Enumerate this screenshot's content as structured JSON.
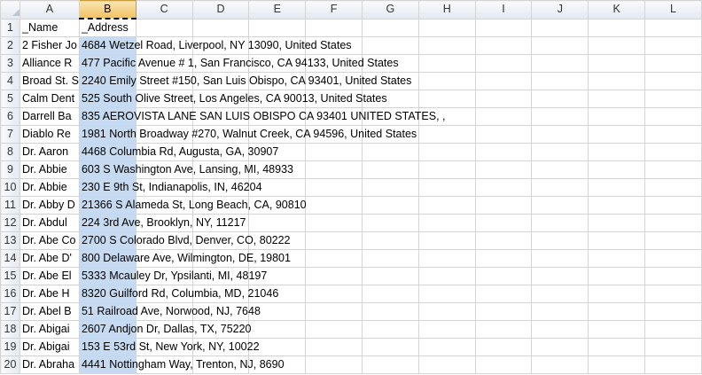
{
  "columns": [
    "A",
    "B",
    "C",
    "D",
    "E",
    "F",
    "G",
    "H",
    "I",
    "J",
    "K",
    "L"
  ],
  "selected_column": "B",
  "rows": [
    {
      "num": "1",
      "a": "_Name",
      "b": "_Address"
    },
    {
      "num": "2",
      "a": "2 Fisher Jo",
      "b": "4684 Wetzel Road, Liverpool, NY 13090, United States"
    },
    {
      "num": "3",
      "a": "Alliance R",
      "b": "477 Pacific Avenue # 1, San Francisco, CA 94133, United States"
    },
    {
      "num": "4",
      "a": "Broad St. S",
      "b": "2240 Emily Street #150, San Luis Obispo, CA 93401, United States"
    },
    {
      "num": "5",
      "a": "Calm Dent",
      "b": "525 South Olive Street, Los Angeles, CA 90013, United States"
    },
    {
      "num": "6",
      "a": "Darrell Ba",
      "b": "835 AEROVISTA LANE  SAN LUIS OBISPO  CA 93401  UNITED STATES, ,"
    },
    {
      "num": "7",
      "a": "Diablo Re",
      "b": "1981 North Broadway #270, Walnut Creek, CA 94596, United States"
    },
    {
      "num": "8",
      "a": "Dr. Aaron",
      "b": "4468 Columbia Rd, Augusta, GA, 30907"
    },
    {
      "num": "9",
      "a": "Dr. Abbie",
      "b": "603 S Washington Ave, Lansing, MI, 48933"
    },
    {
      "num": "10",
      "a": "Dr. Abbie",
      "b": "230 E 9th St, Indianapolis, IN, 46204"
    },
    {
      "num": "11",
      "a": "Dr. Abby D",
      "b": "21366 S Alameda St, Long Beach, CA, 90810"
    },
    {
      "num": "12",
      "a": "Dr. Abdul",
      "b": "224 3rd Ave, Brooklyn, NY, 11217"
    },
    {
      "num": "13",
      "a": "Dr. Abe Co",
      "b": "2700 S Colorado Blvd, Denver, CO, 80222"
    },
    {
      "num": "14",
      "a": "Dr. Abe D'",
      "b": "800 Delaware Ave, Wilmington, DE, 19801"
    },
    {
      "num": "15",
      "a": "Dr. Abe El",
      "b": "5333 Mcauley Dr, Ypsilanti, MI, 48197"
    },
    {
      "num": "16",
      "a": "Dr. Abe H",
      "b": "8320 Guilford Rd, Columbia, MD, 21046"
    },
    {
      "num": "17",
      "a": "Dr. Abel B",
      "b": "51 Railroad Ave, Norwood, NJ, 7648"
    },
    {
      "num": "18",
      "a": "Dr. Abigai",
      "b": "2607 Andjon Dr, Dallas, TX, 75220"
    },
    {
      "num": "19",
      "a": "Dr. Abigai",
      "b": "153 E 53rd St, New York, NY, 10022"
    },
    {
      "num": "20",
      "a": "Dr. Abraha",
      "b": "4441 Nottingham Way, Trenton, NJ, 8690"
    }
  ],
  "colors": {
    "selection": "#c6dbf2",
    "header_selected": "#f1c15f",
    "gridline": "#d4d4d4"
  }
}
